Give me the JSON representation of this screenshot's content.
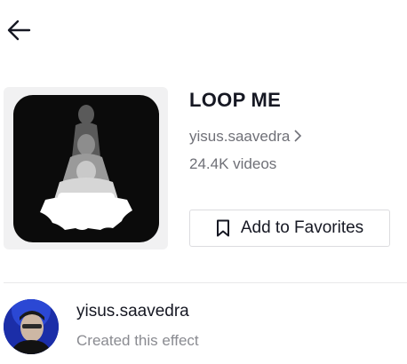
{
  "header": {
    "back_icon": "arrow-left-icon"
  },
  "effect": {
    "title": "LOOP ME",
    "creator_link": "yisus.saavedra",
    "video_count": "24.4K videos",
    "favorite_label": "Add to Favorites",
    "favorite_icon": "bookmark-icon",
    "thumbnail_bg": "#0b0b0b"
  },
  "creator": {
    "name": "yisus.saavedra",
    "subtitle": "Created this effect",
    "avatar_bg": "#1b2ea8"
  }
}
